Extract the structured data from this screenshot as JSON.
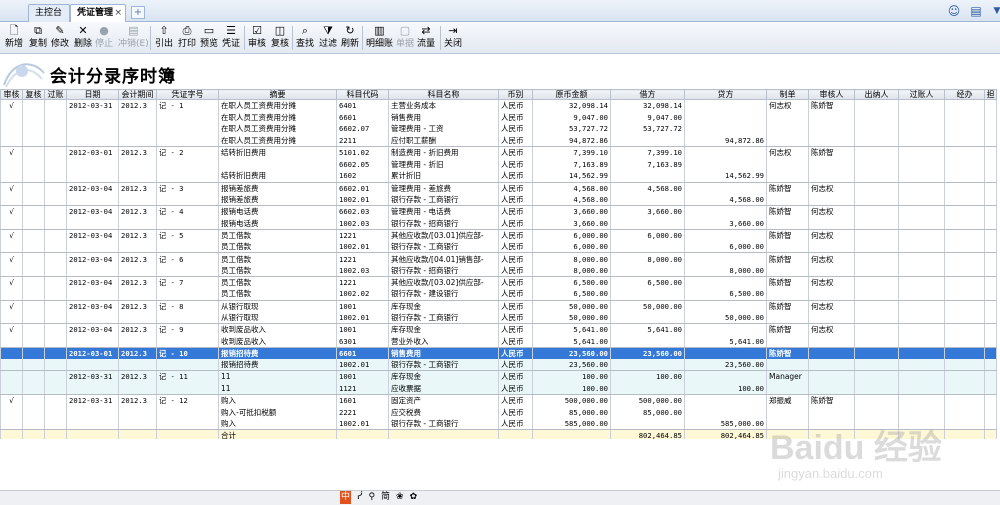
{
  "tabs": [
    {
      "label": "主控台"
    },
    {
      "label": "凭证管理",
      "close": "×"
    }
  ],
  "tab_new": "+",
  "toolbar": [
    {
      "name": "new",
      "label": "新增",
      "icon": "document-icon",
      "glyph": "🗋",
      "disabled": false
    },
    {
      "name": "copy",
      "label": "复制",
      "icon": "copy-icon",
      "glyph": "⧉",
      "disabled": false
    },
    {
      "name": "edit",
      "label": "修改",
      "icon": "edit-icon",
      "glyph": "✎",
      "disabled": false
    },
    {
      "name": "delete",
      "label": "删除",
      "icon": "delete-icon",
      "glyph": "✕",
      "disabled": false
    },
    {
      "name": "stop",
      "label": "停止",
      "icon": "stop-icon",
      "glyph": "●",
      "disabled": true
    },
    {
      "name": "reverse",
      "label": "冲销(E)",
      "icon": "reverse-icon",
      "glyph": "▤",
      "disabled": true
    },
    {
      "name": "export",
      "label": "引出",
      "icon": "export-icon",
      "glyph": "⇧",
      "disabled": false
    },
    {
      "name": "print",
      "label": "打印",
      "icon": "print-icon",
      "glyph": "⎙",
      "disabled": false
    },
    {
      "name": "preview",
      "label": "预览",
      "icon": "preview-icon",
      "glyph": "▭",
      "disabled": false
    },
    {
      "name": "voucher",
      "label": "凭证",
      "icon": "voucher-icon",
      "glyph": "☰",
      "disabled": false
    },
    {
      "name": "audit",
      "label": "审核",
      "icon": "audit-icon",
      "glyph": "☑",
      "disabled": false
    },
    {
      "name": "review",
      "label": "复核",
      "icon": "review-icon",
      "glyph": "◫",
      "disabled": false
    },
    {
      "name": "find",
      "label": "查找",
      "icon": "find-icon",
      "glyph": "⌕",
      "disabled": false
    },
    {
      "name": "filter",
      "label": "过滤",
      "icon": "filter-icon",
      "glyph": "⧩",
      "disabled": false
    },
    {
      "name": "refresh",
      "label": "刷新",
      "icon": "refresh-icon",
      "glyph": "↻",
      "disabled": false
    },
    {
      "name": "detail",
      "label": "明细账",
      "icon": "ledger-icon",
      "glyph": "▥",
      "disabled": false
    },
    {
      "name": "document",
      "label": "单据",
      "icon": "bill-icon",
      "glyph": "▢",
      "disabled": true
    },
    {
      "name": "flow",
      "label": "流量",
      "icon": "flow-icon",
      "glyph": "⇄",
      "disabled": false
    },
    {
      "name": "close",
      "label": "关闭",
      "icon": "exit-icon",
      "glyph": "⇥",
      "disabled": false
    }
  ],
  "title": "会计分录序时簿",
  "columns": [
    "审核",
    "复核",
    "过账",
    "日期",
    "会计期间",
    "凭证字号",
    "摘要",
    "科目代码",
    "科目名称",
    "币别",
    "原币金额",
    "借方",
    "贷方",
    "制单",
    "审核人",
    "出纳人",
    "过账人",
    "经办",
    "担"
  ],
  "rows": [
    {
      "audit": "√",
      "date": "2012-03-31",
      "period": "2012.3",
      "voucher": "记 - 1",
      "summary": "在职人员工资费用分摊",
      "code": "6401",
      "account": "主营业务成本",
      "currency": "人民币",
      "amount": "32,098.14",
      "debit": "32,098.14",
      "credit": "",
      "maker": "何志权",
      "auditor": "陈娇智",
      "end": false,
      "style": ""
    },
    {
      "audit": "",
      "date": "",
      "period": "",
      "voucher": "",
      "summary": "在职人员工资费用分摊",
      "code": "6601",
      "account": "销售费用",
      "currency": "人民币",
      "amount": "9,047.00",
      "debit": "9,047.00",
      "credit": "",
      "maker": "",
      "auditor": "",
      "end": false,
      "style": ""
    },
    {
      "audit": "",
      "date": "",
      "period": "",
      "voucher": "",
      "summary": "在职人员工资费用分摊",
      "code": "6602.07",
      "account": "管理费用 - 工资",
      "currency": "人民币",
      "amount": "53,727.72",
      "debit": "53,727.72",
      "credit": "",
      "maker": "",
      "auditor": "",
      "end": false,
      "style": ""
    },
    {
      "audit": "",
      "date": "",
      "period": "",
      "voucher": "",
      "summary": "在职人员工资费用分摊",
      "code": "2211",
      "account": "应付职工薪酬",
      "currency": "人民币",
      "amount": "94,872.86",
      "debit": "",
      "credit": "94,872.86",
      "maker": "",
      "auditor": "",
      "end": true,
      "style": ""
    },
    {
      "audit": "√",
      "date": "2012-03-01",
      "period": "2012.3",
      "voucher": "记 - 2",
      "summary": "结转折旧费用",
      "code": "5101.02",
      "account": "制造费用 - 折旧费用",
      "currency": "人民币",
      "amount": "7,399.10",
      "debit": "7,399.10",
      "credit": "",
      "maker": "何志权",
      "auditor": "陈娇智",
      "end": false,
      "style": ""
    },
    {
      "audit": "",
      "date": "",
      "period": "",
      "voucher": "",
      "summary": "",
      "code": "6602.05",
      "account": "管理费用 - 折旧",
      "currency": "人民币",
      "amount": "7,163.89",
      "debit": "7,163.89",
      "credit": "",
      "maker": "",
      "auditor": "",
      "end": false,
      "style": ""
    },
    {
      "audit": "",
      "date": "",
      "period": "",
      "voucher": "",
      "summary": "结转折旧费用",
      "code": "1602",
      "account": "累计折旧",
      "currency": "人民币",
      "amount": "14,562.99",
      "debit": "",
      "credit": "14,562.99",
      "maker": "",
      "auditor": "",
      "end": true,
      "style": ""
    },
    {
      "audit": "√",
      "date": "2012-03-04",
      "period": "2012.3",
      "voucher": "记 - 3",
      "summary": "报销差旅费",
      "code": "6602.01",
      "account": "管理费用 - 差旅费",
      "currency": "人民币",
      "amount": "4,568.00",
      "debit": "4,568.00",
      "credit": "",
      "maker": "陈娇智",
      "auditor": "何志权",
      "end": false,
      "style": ""
    },
    {
      "audit": "",
      "date": "",
      "period": "",
      "voucher": "",
      "summary": "报销差旅费",
      "code": "1002.01",
      "account": "银行存款 - 工商银行",
      "currency": "人民币",
      "amount": "4,568.00",
      "debit": "",
      "credit": "4,568.00",
      "maker": "",
      "auditor": "",
      "end": true,
      "style": ""
    },
    {
      "audit": "√",
      "date": "2012-03-04",
      "period": "2012.3",
      "voucher": "记 - 4",
      "summary": "报销电话费",
      "code": "6602.03",
      "account": "管理费用 - 电话费",
      "currency": "人民币",
      "amount": "3,660.00",
      "debit": "3,660.00",
      "credit": "",
      "maker": "陈娇智",
      "auditor": "何志权",
      "end": false,
      "style": ""
    },
    {
      "audit": "",
      "date": "",
      "period": "",
      "voucher": "",
      "summary": "报销电话费",
      "code": "1002.03",
      "account": "银行存款 - 招商银行",
      "currency": "人民币",
      "amount": "3,660.00",
      "debit": "",
      "credit": "3,660.00",
      "maker": "",
      "auditor": "",
      "end": true,
      "style": ""
    },
    {
      "audit": "√",
      "date": "2012-03-04",
      "period": "2012.3",
      "voucher": "记 - 5",
      "summary": "员工借款",
      "code": "1221",
      "account": "其他应收款/[03.01]供应部-",
      "currency": "人民币",
      "amount": "6,000.00",
      "debit": "6,000.00",
      "credit": "",
      "maker": "陈娇智",
      "auditor": "何志权",
      "end": false,
      "style": ""
    },
    {
      "audit": "",
      "date": "",
      "period": "",
      "voucher": "",
      "summary": "员工借款",
      "code": "1002.01",
      "account": "银行存款 - 工商银行",
      "currency": "人民币",
      "amount": "6,000.00",
      "debit": "",
      "credit": "6,000.00",
      "maker": "",
      "auditor": "",
      "end": true,
      "style": ""
    },
    {
      "audit": "√",
      "date": "2012-03-04",
      "period": "2012.3",
      "voucher": "记 - 6",
      "summary": "员工借款",
      "code": "1221",
      "account": "其他应收款/[04.01]销售部-",
      "currency": "人民币",
      "amount": "8,000.00",
      "debit": "8,000.00",
      "credit": "",
      "maker": "陈娇智",
      "auditor": "何志权",
      "end": false,
      "style": ""
    },
    {
      "audit": "",
      "date": "",
      "period": "",
      "voucher": "",
      "summary": "员工借款",
      "code": "1002.03",
      "account": "银行存款 - 招商银行",
      "currency": "人民币",
      "amount": "8,000.00",
      "debit": "",
      "credit": "8,000.00",
      "maker": "",
      "auditor": "",
      "end": true,
      "style": ""
    },
    {
      "audit": "√",
      "date": "2012-03-04",
      "period": "2012.3",
      "voucher": "记 - 7",
      "summary": "员工借款",
      "code": "1221",
      "account": "其他应收款/[03.02]供应部-",
      "currency": "人民币",
      "amount": "6,500.00",
      "debit": "6,500.00",
      "credit": "",
      "maker": "陈娇智",
      "auditor": "何志权",
      "end": false,
      "style": ""
    },
    {
      "audit": "",
      "date": "",
      "period": "",
      "voucher": "",
      "summary": "员工借款",
      "code": "1002.02",
      "account": "银行存款 - 建设银行",
      "currency": "人民币",
      "amount": "6,500.00",
      "debit": "",
      "credit": "6,500.00",
      "maker": "",
      "auditor": "",
      "end": true,
      "style": ""
    },
    {
      "audit": "√",
      "date": "2012-03-04",
      "period": "2012.3",
      "voucher": "记 - 8",
      "summary": "从银行取现",
      "code": "1001",
      "account": "库存现金",
      "currency": "人民币",
      "amount": "50,000.00",
      "debit": "50,000.00",
      "credit": "",
      "maker": "陈娇智",
      "auditor": "何志权",
      "end": false,
      "style": ""
    },
    {
      "audit": "",
      "date": "",
      "period": "",
      "voucher": "",
      "summary": "从银行取现",
      "code": "1002.01",
      "account": "银行存款 - 工商银行",
      "currency": "人民币",
      "amount": "50,000.00",
      "debit": "",
      "credit": "50,000.00",
      "maker": "",
      "auditor": "",
      "end": true,
      "style": ""
    },
    {
      "audit": "√",
      "date": "2012-03-04",
      "period": "2012.3",
      "voucher": "记 - 9",
      "summary": "收到废品收入",
      "code": "1001",
      "account": "库存现金",
      "currency": "人民币",
      "amount": "5,641.00",
      "debit": "5,641.00",
      "credit": "",
      "maker": "陈娇智",
      "auditor": "何志权",
      "end": false,
      "style": ""
    },
    {
      "audit": "",
      "date": "",
      "period": "",
      "voucher": "",
      "summary": "收到废品收入",
      "code": "6301",
      "account": "营业外收入",
      "currency": "人民币",
      "amount": "5,641.00",
      "debit": "",
      "credit": "5,641.00",
      "maker": "",
      "auditor": "",
      "end": true,
      "style": ""
    },
    {
      "audit": "",
      "date": "2012-03-01",
      "period": "2012.3",
      "voucher": "记 - 10",
      "summary": "报销招待费",
      "code": "6601",
      "account": "销售费用",
      "currency": "人民币",
      "amount": "23,560.00",
      "debit": "23,560.00",
      "credit": "",
      "maker": "陈娇智",
      "auditor": "",
      "end": false,
      "style": "sel"
    },
    {
      "audit": "",
      "date": "",
      "period": "",
      "voucher": "",
      "summary": "报销招待费",
      "code": "1002.01",
      "account": "银行存款 - 工商银行",
      "currency": "人民币",
      "amount": "23,560.00",
      "debit": "",
      "credit": "23,560.00",
      "maker": "",
      "auditor": "",
      "end": true,
      "style": "alt"
    },
    {
      "audit": "",
      "date": "2012-03-31",
      "period": "2012.3",
      "voucher": "记 - 11",
      "summary": "11",
      "code": "1001",
      "account": "库存现金",
      "currency": "人民币",
      "amount": "100.00",
      "debit": "100.00",
      "credit": "",
      "maker": "Manager",
      "auditor": "",
      "end": false,
      "style": "alt"
    },
    {
      "audit": "",
      "date": "",
      "period": "",
      "voucher": "",
      "summary": "11",
      "code": "1121",
      "account": "应收票据",
      "currency": "人民币",
      "amount": "100.00",
      "debit": "",
      "credit": "100.00",
      "maker": "",
      "auditor": "",
      "end": true,
      "style": "alt"
    },
    {
      "audit": "√",
      "date": "2012-03-31",
      "period": "2012.3",
      "voucher": "记 - 12",
      "summary": "购入",
      "code": "1601",
      "account": "固定资产",
      "currency": "人民币",
      "amount": "500,000.00",
      "debit": "500,000.00",
      "credit": "",
      "maker": "郑振威",
      "auditor": "陈娇智",
      "end": false,
      "style": ""
    },
    {
      "audit": "",
      "date": "",
      "period": "",
      "voucher": "",
      "summary": "购入-可抵扣税额",
      "code": "2221",
      "account": "应交税费",
      "currency": "人民币",
      "amount": "85,000.00",
      "debit": "85,000.00",
      "credit": "",
      "maker": "",
      "auditor": "",
      "end": false,
      "style": ""
    },
    {
      "audit": "",
      "date": "",
      "period": "",
      "voucher": "",
      "summary": "购入",
      "code": "1002.01",
      "account": "银行存款 - 工商银行",
      "currency": "人民币",
      "amount": "585,000.00",
      "debit": "",
      "credit": "585,000.00",
      "maker": "",
      "auditor": "",
      "end": true,
      "style": ""
    }
  ],
  "total": {
    "label": "合计",
    "debit": "802,464.85",
    "credit": "802,464.85"
  },
  "ime": [
    "中",
    "ᓰ",
    "⚲",
    "简",
    "❀",
    "✿"
  ],
  "watermark": {
    "brand": "Baidu 经验",
    "url": "jingyan.baidu.com"
  }
}
